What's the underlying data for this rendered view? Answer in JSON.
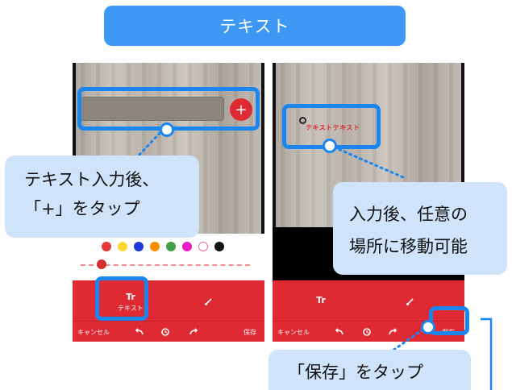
{
  "title": "テキスト",
  "callouts": {
    "step1_line1": "テキスト入力後、",
    "step1_line2": "「+」をタップ",
    "step2_line1": "入力後、任意の",
    "step2_line2": "場所に移動可能",
    "step3": "「保存」をタップ"
  },
  "left_phone": {
    "plus_label": "+",
    "tool_icon_label": "Tr",
    "tool_label": "テキスト",
    "cancel_label": "キャンセル",
    "save_label": "保存",
    "colors": [
      "#e53935",
      "#fdd835",
      "#1e3ad8",
      "#fb8c00",
      "#43a047",
      "#e91ec8",
      "#ffffff",
      "#111111"
    ]
  },
  "right_phone": {
    "sample_text": "テキストテキスト",
    "tool_icon_label": "Tr",
    "cancel_label": "キャンセル",
    "save_label": "保存"
  },
  "icons": {
    "undo": "undo-icon",
    "history": "history-icon",
    "redo": "redo-icon",
    "brush": "brush-icon"
  },
  "accent_color": "#1a86f0",
  "toolbar_color": "#e02a33"
}
